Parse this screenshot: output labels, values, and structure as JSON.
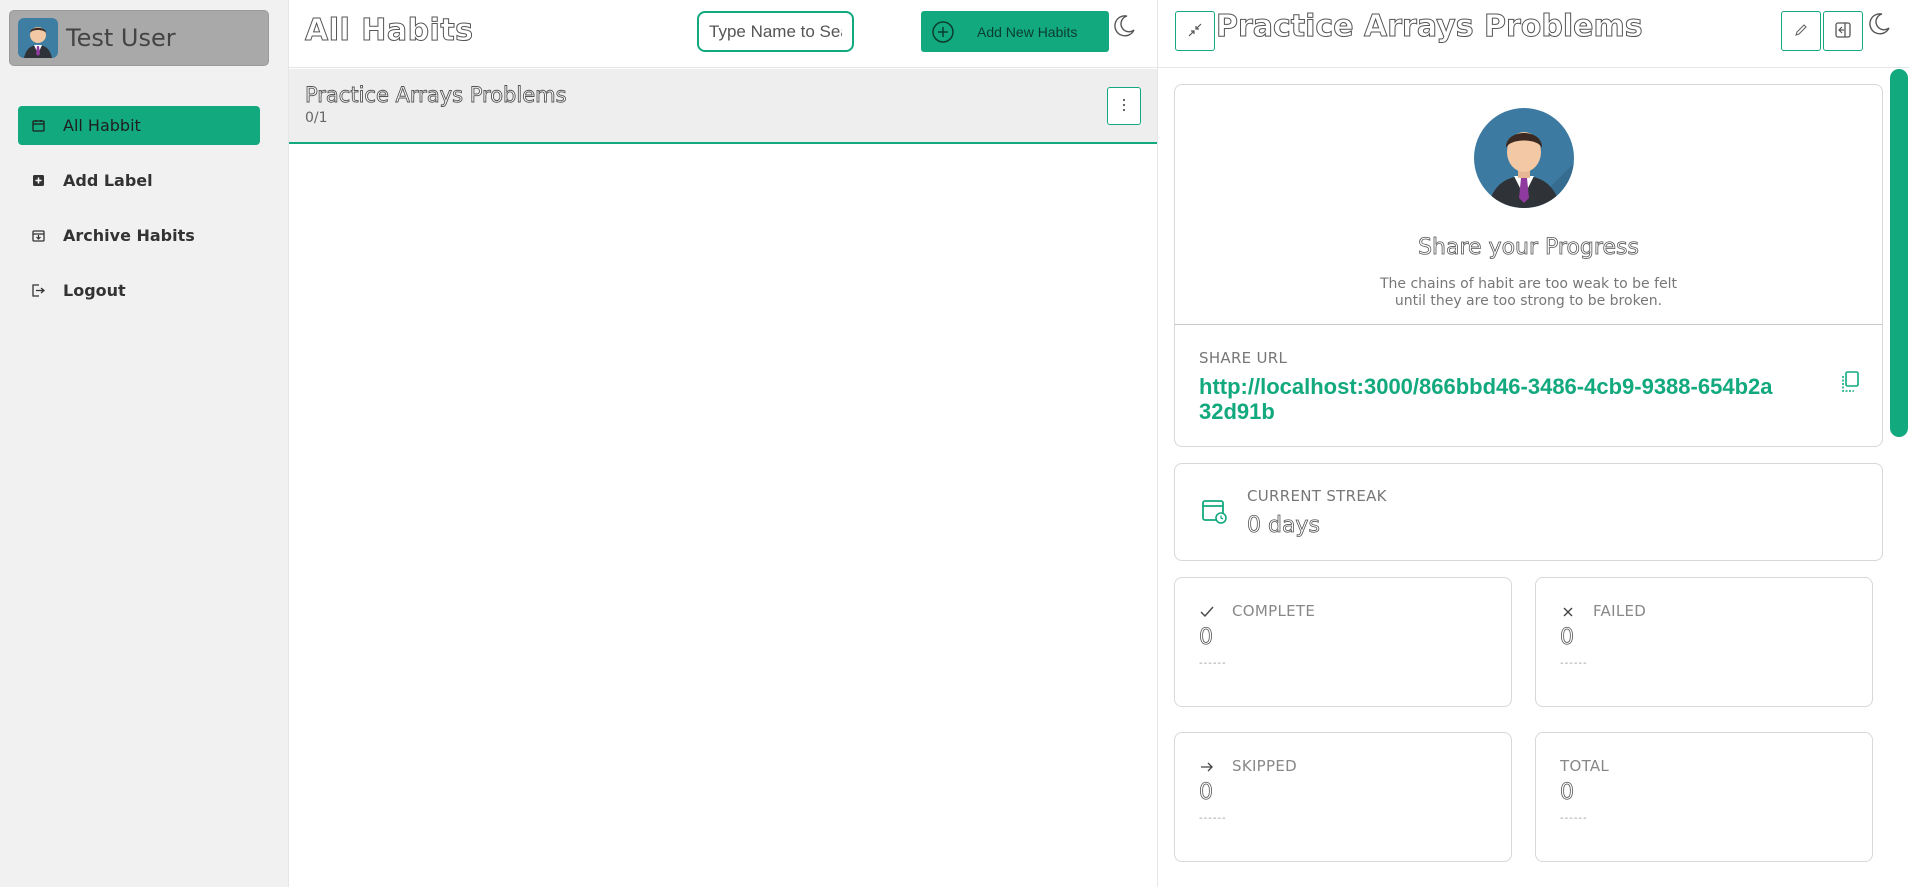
{
  "sidebar": {
    "user_name": "Test User",
    "items": [
      {
        "label": "All Habbit",
        "icon": "calendar-icon"
      },
      {
        "label": "Add Label",
        "icon": "add-label-icon"
      },
      {
        "label": "Archive Habits",
        "icon": "archive-icon"
      },
      {
        "label": "Logout",
        "icon": "logout-icon"
      }
    ]
  },
  "middle": {
    "title": "All Habits",
    "search_placeholder": "Type Name to Search!",
    "add_button_label": "Add New Habits",
    "habits": [
      {
        "name": "Practice Arrays Problems",
        "progress": "0/1"
      }
    ]
  },
  "detail": {
    "title": "Practice Arrays Problems",
    "share_title": "Share your Progress",
    "share_quote": "The chains of habit are too weak to be felt until they are too strong to be broken.",
    "share_url_label": "SHARE URL",
    "share_url": "http://localhost:3000/866bbd46-3486-4cb9-9388-654b2a32d91b",
    "streak_label": "CURRENT STREAK",
    "streak_value": "0 days",
    "stats": {
      "complete": {
        "label": "COMPLETE",
        "value": "0",
        "dash": "------"
      },
      "failed": {
        "label": "FAILED",
        "value": "0",
        "dash": "------"
      },
      "skipped": {
        "label": "SKIPPED",
        "value": "0",
        "dash": "------"
      },
      "total": {
        "label": "TOTAL",
        "value": "0",
        "dash": "------"
      }
    }
  },
  "colors": {
    "accent": "#12a97e",
    "sidebar_bg": "#f1f1f1",
    "user_card_bg": "#a9a9a9"
  }
}
